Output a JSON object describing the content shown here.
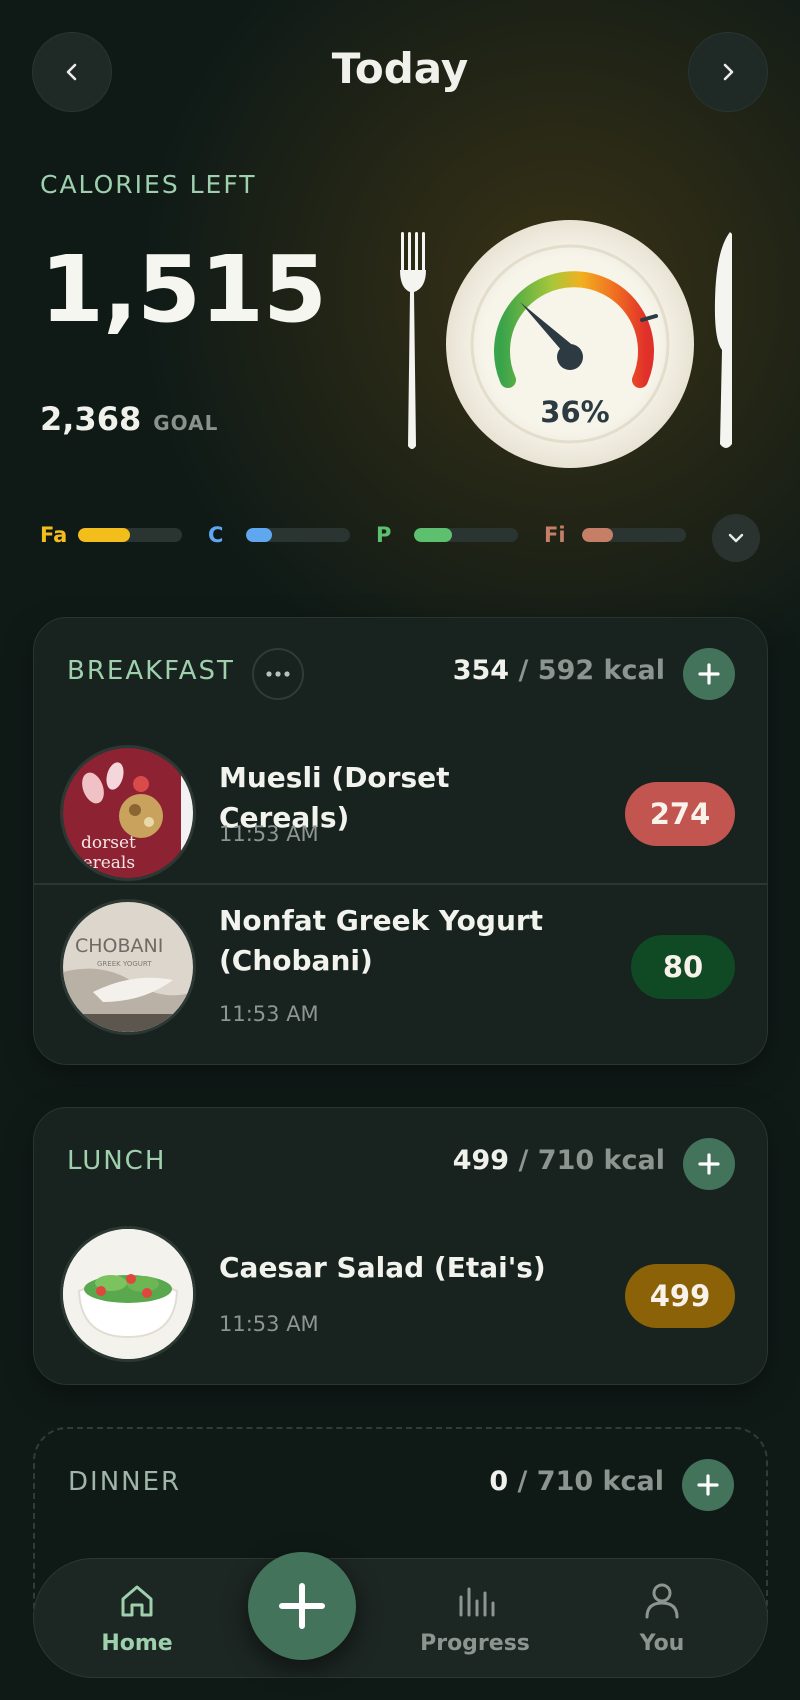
{
  "header": {
    "title": "Today"
  },
  "summary": {
    "calories_left_label": "CALORIES LEFT",
    "calories_left": "1,515",
    "goal_value": "2,368",
    "goal_label": "GOAL",
    "progress_percent_text": "36%",
    "progress_fraction": 0.36
  },
  "macros": [
    {
      "label": "Fa",
      "color": "#f3bd1c",
      "fill": 0.5
    },
    {
      "label": "C",
      "color": "#5fa8ef",
      "fill": 0.25
    },
    {
      "label": "P",
      "color": "#5cc06f",
      "fill": 0.37
    },
    {
      "label": "Fi",
      "color": "#c47f66",
      "fill": 0.3
    }
  ],
  "meals": {
    "breakfast": {
      "name": "BREAKFAST",
      "consumed": "354",
      "separator": "/",
      "target": "592 kcal",
      "items": [
        {
          "name": "Muesli (Dorset Cereals)",
          "time": "11:53 AM",
          "kcal": "274",
          "badge_color": "#c2554f",
          "thumb_text_1": "dorset",
          "thumb_text_2": "cereals"
        },
        {
          "name": "Nonfat Greek Yogurt (Chobani)",
          "time": "11:53 AM",
          "kcal": "80",
          "badge_color": "#0f4a24",
          "thumb_text_1": "CHOBANI",
          "thumb_text_2": "GREEK YOGURT"
        }
      ]
    },
    "lunch": {
      "name": "LUNCH",
      "consumed": "499",
      "separator": "/",
      "target": "710 kcal",
      "items": [
        {
          "name": "Caesar Salad (Etai's)",
          "time": "11:53 AM",
          "kcal": "499",
          "badge_color": "#8b6208"
        }
      ]
    },
    "dinner": {
      "name": "DINNER",
      "consumed": "0",
      "separator": "/",
      "target": "710 kcal"
    }
  },
  "bottom_nav": {
    "home": "Home",
    "progress": "Progress",
    "you": "You"
  },
  "colors": {
    "accent": "#44735c",
    "label_green": "#9fd0ae",
    "background": "#0f1a17"
  }
}
